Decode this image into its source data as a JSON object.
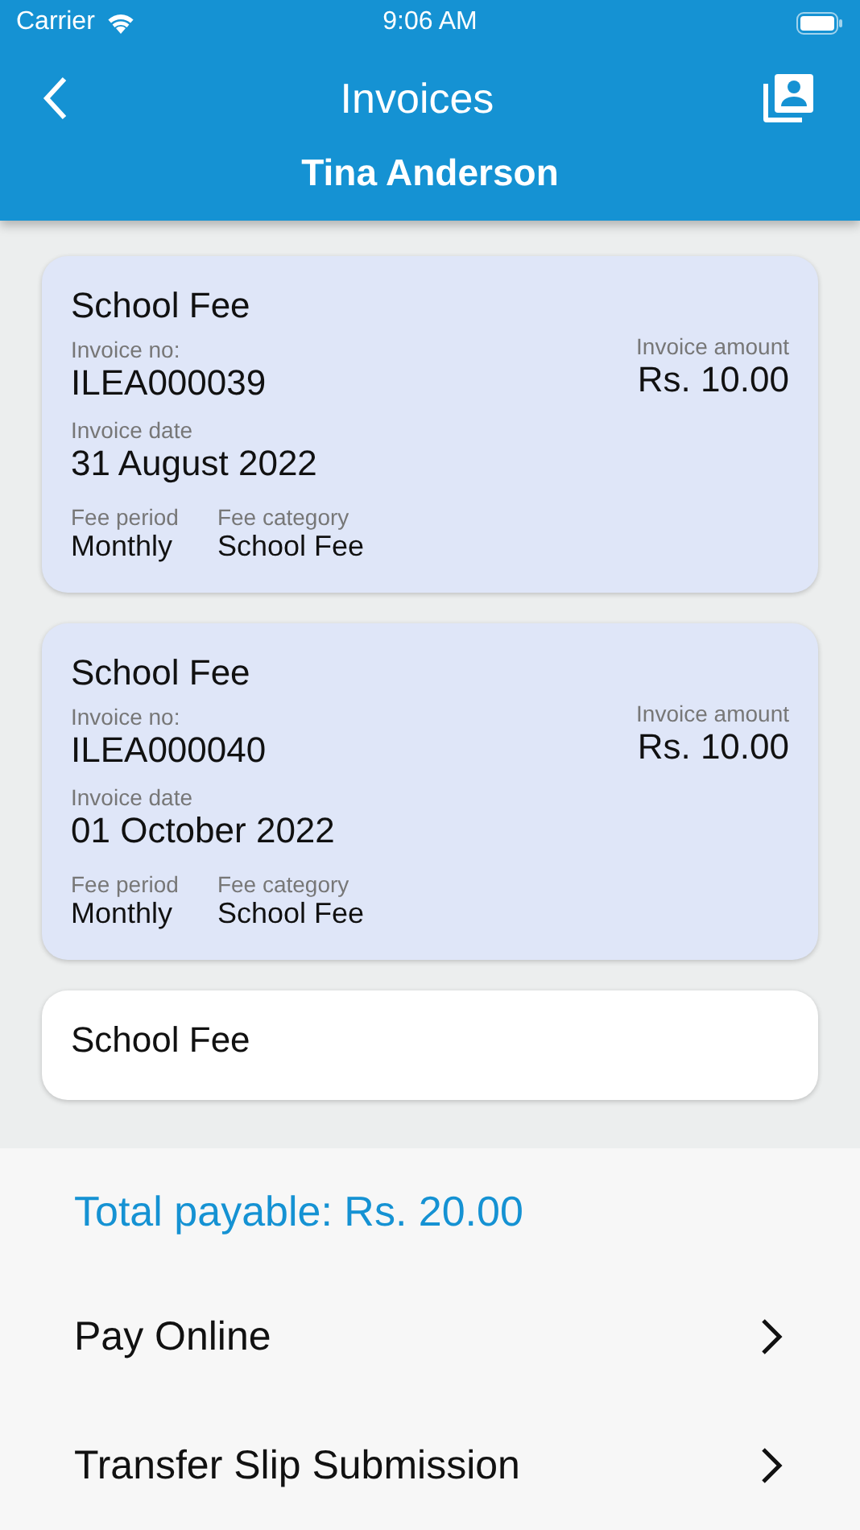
{
  "status_bar": {
    "carrier": "Carrier",
    "time": "9:06 AM"
  },
  "header": {
    "title": "Invoices",
    "subtitle": "Tina Anderson"
  },
  "invoices": [
    {
      "title": "School Fee",
      "selected": true,
      "invoice_no_label": "Invoice no:",
      "invoice_no": "ILEA000039",
      "date_label": "Invoice date",
      "date": "31 August 2022",
      "period_label": "Fee period",
      "period": "Monthly",
      "category_label": "Fee category",
      "category": "School Fee",
      "amount_label": "Invoice amount",
      "amount": "Rs. 10.00"
    },
    {
      "title": "School Fee",
      "selected": true,
      "invoice_no_label": "Invoice no:",
      "invoice_no": "ILEA000040",
      "date_label": "Invoice date",
      "date": "01 October 2022",
      "period_label": "Fee period",
      "period": "Monthly",
      "category_label": "Fee category",
      "category": "School Fee",
      "amount_label": "Invoice amount",
      "amount": "Rs. 10.00"
    },
    {
      "title": "School Fee",
      "selected": false
    }
  ],
  "footer": {
    "total": "Total payable: Rs. 20.00",
    "actions": [
      "Pay Online",
      "Transfer Slip Submission"
    ]
  }
}
